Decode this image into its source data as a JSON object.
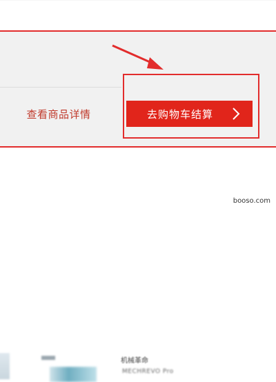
{
  "actions": {
    "view_details_label": "查看商品详情",
    "checkout_label": "去购物车结算"
  },
  "products": {
    "title": "机械革命",
    "subtitle": "MECHREVO Pro"
  },
  "watermark": "booso.com",
  "colors": {
    "accent": "#e1251b",
    "highlight": "#e22c2c",
    "panel_bg": "#f1f1f1"
  }
}
